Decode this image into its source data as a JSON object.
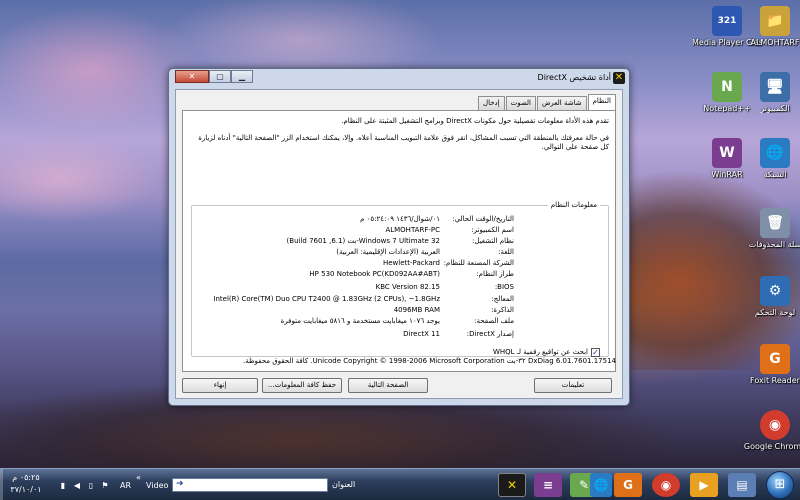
{
  "desktop": {
    "icons": [
      {
        "label": "Media Player Classic",
        "glyph": "321",
        "color": "#2d57b0"
      },
      {
        "label": "ALMOHTARF",
        "glyph": "📁",
        "color": "#c9a23a"
      },
      {
        "label": "Notepad++",
        "glyph": "N",
        "color": "#6aa84f"
      },
      {
        "label": "الكمبيوتر",
        "glyph": "🖥",
        "color": "#3d6ea8"
      },
      {
        "label": "WinRAR",
        "glyph": "W",
        "color": "#7a3d8f"
      },
      {
        "label": "الشبكة",
        "glyph": "🌐",
        "color": "#2b7bc2"
      },
      {
        "label": "سلة المحذوفات",
        "glyph": "🗑",
        "color": "#7f8fa8"
      },
      {
        "label": "لوحة التحكم",
        "glyph": "⚙",
        "color": "#2e6db4"
      },
      {
        "label": "Foxit Reader",
        "glyph": "G",
        "color": "#e07018"
      },
      {
        "label": "Google Chrome",
        "glyph": "◉",
        "color": "#d23c2c"
      }
    ]
  },
  "window": {
    "title": "أداة تشخيص DirectX",
    "icon": "directx-icon",
    "controls": {
      "minimize": "▁",
      "maximize": "▢",
      "close": "✕"
    }
  },
  "tabs": [
    {
      "label": "النظام",
      "active": true
    },
    {
      "label": "شاشة العرض",
      "active": false
    },
    {
      "label": "الصوت",
      "active": false
    },
    {
      "label": "إدخال",
      "active": false
    }
  ],
  "intro": {
    "p1": "تقدم هذه الأداة معلومات تفصيلية حول مكونات DirectX وبرامج التشغيل المثبتة على النظام.",
    "p2": "في حالة معرفتك بالمنطقة التي تسبب المشاكل، انقر فوق علامة التبويب المناسبة أعلاه. وإلا، يمكنك استخدام الزر \"الصفحة التالية\" أدناه لزيارة كل صفحة على التوالي."
  },
  "system_info": {
    "title": "معلومات النظام",
    "rows": [
      {
        "label": "التاريخ/الوقت الحالي:",
        "value": "٠١/شوال/١٤٣٦ ٠٥:٢٤:٠٩ م"
      },
      {
        "label": "اسم الكمبيوتر:",
        "value": "ALMOHTARF-PC"
      },
      {
        "label": "نظام التشغيل:",
        "value": "Windows 7 Ultimate 32-بت (6.1, Build 7601)"
      },
      {
        "label": "اللغة:",
        "value": "العربية (الإعدادات الإقليمية: العربية)"
      },
      {
        "label": "الشركة المصنعة للنظام:",
        "value": "Hewlett-Packard"
      },
      {
        "label": "طراز النظام:",
        "value": "HP 530 Notebook PC(KD092AA#ABT)"
      },
      {
        "label": "BIOS:",
        "value": "KBC Version 82.15"
      },
      {
        "label": "المعالج:",
        "value": "Intel(R) Core(TM) Duo CPU      T2400  @ 1.83GHz (2 CPUs), ~1.8GHz"
      },
      {
        "label": "الذاكرة:",
        "value": "4096MB RAM"
      },
      {
        "label": "ملف الصفحة:",
        "value": "يوجد ١٠٧٦ ميغابايت مستخدمة و ٥٨١٦ ميغابايت متوفرة"
      },
      {
        "label": "إصدار DirectX:",
        "value": "DirectX 11"
      }
    ],
    "whql_label": "ابحث عن تواقيع رقمية لـ WHQL",
    "whql_checked": "✓"
  },
  "copyright": "DxDiag 6.01.7601.17514 ٣٢-بت Unicode  Copyright © 1998-2006 Microsoft Corporation.  كافة الحقوق محفوظة.",
  "buttons": {
    "help": "تعليمات",
    "next_page": "الصفحة التالية",
    "save_info": "حفظ كافة المعلومات...",
    "exit": "إنهاء"
  },
  "taskbar": {
    "address_label": "العنوان",
    "address_value": "",
    "video_label": "Video",
    "lang": "AR",
    "chevron": "«",
    "clock_time": "٠٥:٢٥ م",
    "clock_date": "٣٧/١٠/٠١",
    "apps": [
      {
        "glyph": "✕",
        "color": "#1a1a1a",
        "active": true,
        "name": "directx-task"
      },
      {
        "glyph": "≡",
        "color": "#7a3d8f",
        "active": false,
        "name": "winrar-task"
      },
      {
        "glyph": "✎",
        "color": "#6aa84f",
        "active": false,
        "name": "notepad-task"
      },
      {
        "glyph": "🌐",
        "color": "#2b7bc2",
        "active": false,
        "name": "network-task"
      },
      {
        "glyph": "G",
        "color": "#e07018",
        "active": false,
        "name": "foxit-task"
      },
      {
        "glyph": "◉",
        "color": "#d23c2c",
        "active": false,
        "name": "chrome-task"
      },
      {
        "glyph": "▶",
        "color": "#e8a020",
        "active": false,
        "name": "media-task"
      },
      {
        "glyph": "▤",
        "color": "#5b7fb5",
        "active": false,
        "name": "explorer-task"
      },
      {
        "glyph": "◐",
        "color": "#c9a23a",
        "active": false,
        "name": "folder-task"
      }
    ]
  }
}
